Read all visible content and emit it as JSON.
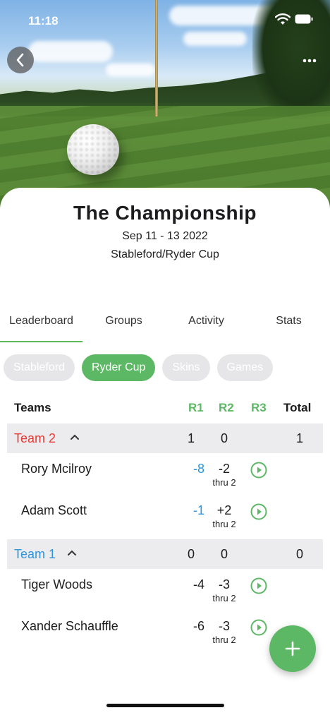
{
  "status_bar": {
    "time": "11:18"
  },
  "header": {
    "back_icon": "chevron-left-icon",
    "more_icon": "ellipsis-icon"
  },
  "event": {
    "title": "The Championship",
    "dates": "Sep 11 - 13 2022",
    "format": "Stableford/Ryder Cup"
  },
  "tabs": [
    {
      "label": "Leaderboard",
      "active": true
    },
    {
      "label": "Groups"
    },
    {
      "label": "Activity"
    },
    {
      "label": "Stats"
    }
  ],
  "chips": [
    {
      "label": "Stableford"
    },
    {
      "label": "Ryder Cup",
      "active": true
    },
    {
      "label": "Skins"
    },
    {
      "label": "Games"
    }
  ],
  "table": {
    "headers": {
      "teams": "Teams",
      "r1": "R1",
      "r2": "R2",
      "r3": "R3",
      "total": "Total"
    },
    "teams": [
      {
        "name": "Team 2",
        "color": "#e53935",
        "r1": "1",
        "r2": "0",
        "r3": "",
        "total": "1",
        "players": [
          {
            "name": "Rory Mcilroy",
            "r1": "-8",
            "r1_blue": true,
            "r2": "-2",
            "thru": "thru 2"
          },
          {
            "name": "Adam Scott",
            "r1": "-1",
            "r1_blue": true,
            "r2": "+2",
            "thru": "thru 2"
          }
        ]
      },
      {
        "name": "Team 1",
        "color": "#2d95db",
        "r1": "0",
        "r2": "0",
        "r3": "",
        "total": "0",
        "players": [
          {
            "name": "Tiger Woods",
            "r1": "-4",
            "r2": "-3",
            "thru": "thru 2"
          },
          {
            "name": "Xander Schauffle",
            "r1": "-6",
            "r2": "-3",
            "thru": "thru 2"
          }
        ]
      }
    ]
  },
  "fab": {
    "icon": "plus-icon"
  },
  "colors": {
    "accent_green": "#5cb865",
    "team2_red": "#e53935",
    "team1_blue": "#2d95db"
  }
}
